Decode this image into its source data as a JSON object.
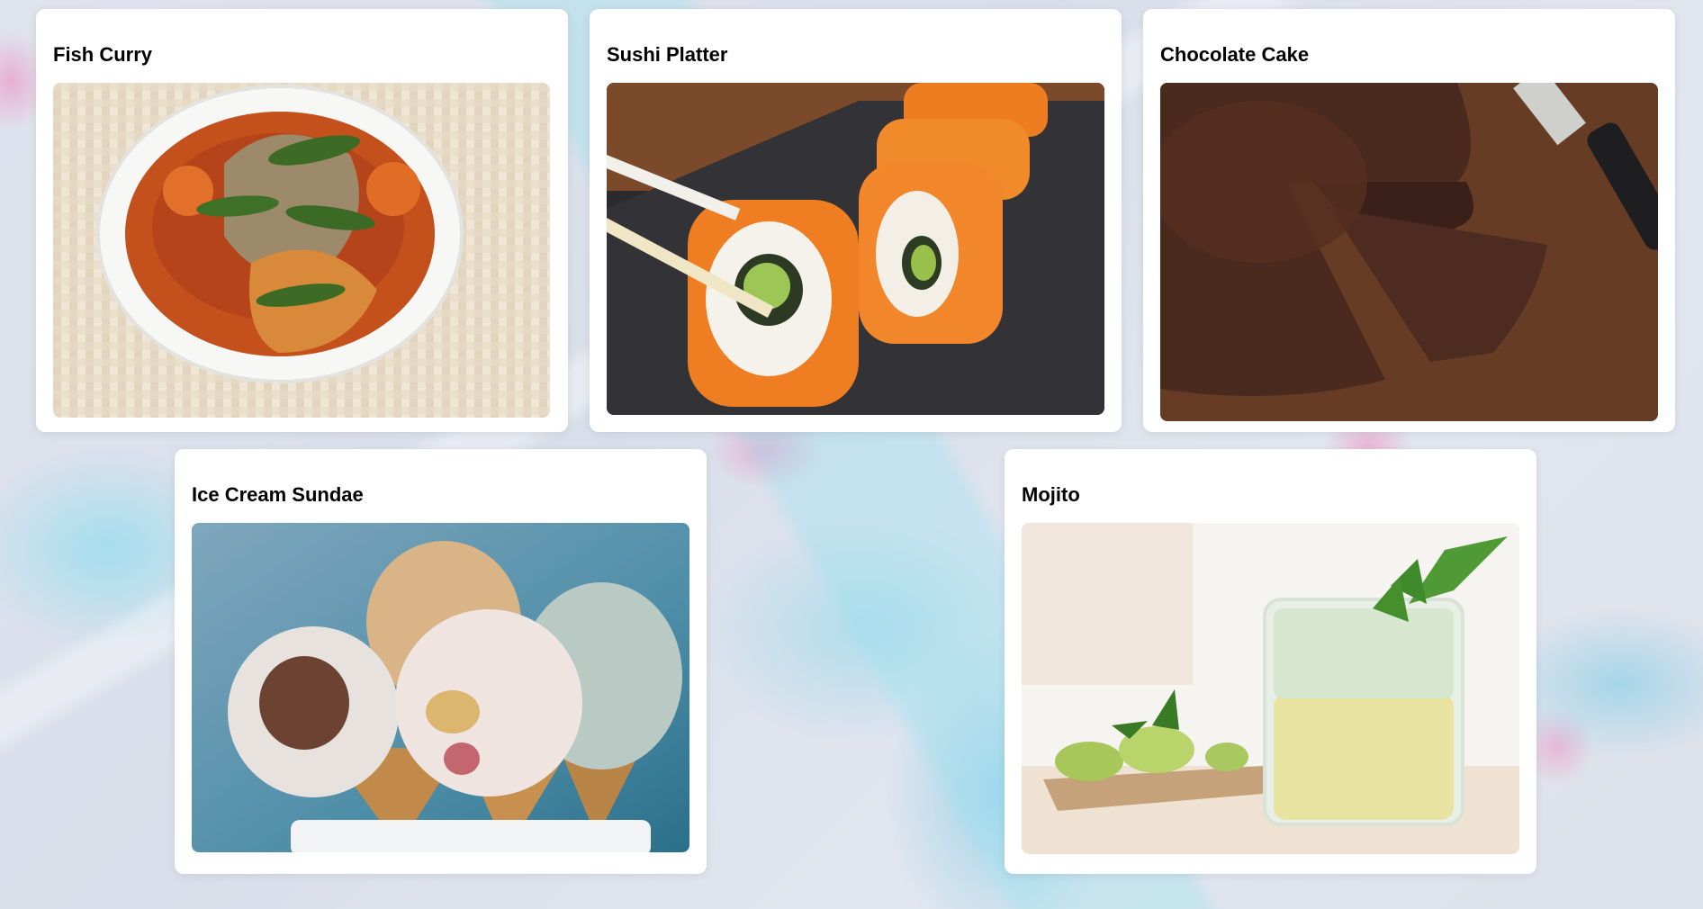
{
  "menu": {
    "items": [
      {
        "title": "Fish Curry"
      },
      {
        "title": "Sushi Platter"
      },
      {
        "title": "Chocolate Cake"
      },
      {
        "title": "Ice Cream Sundae"
      },
      {
        "title": "Mojito"
      }
    ]
  }
}
